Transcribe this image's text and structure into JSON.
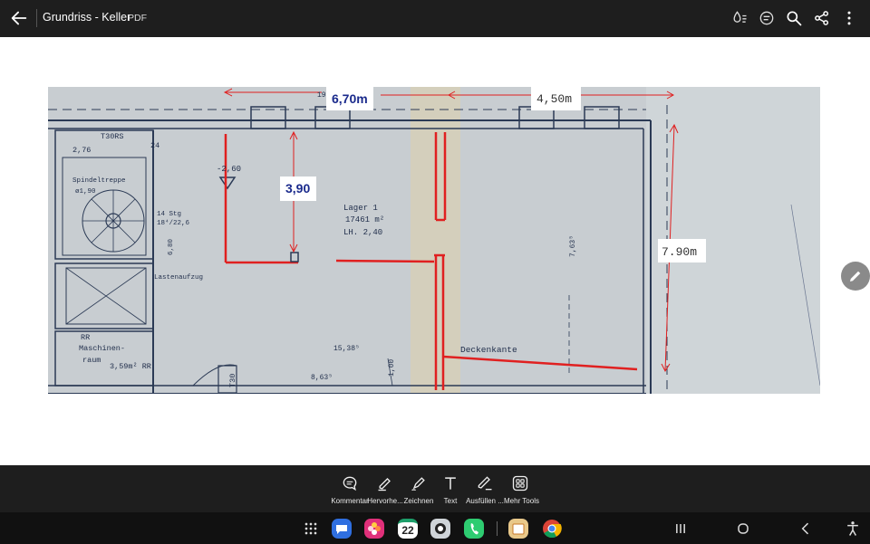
{
  "header": {
    "title": "Grundriss - Keller",
    "file_type": "PDF",
    "icons": [
      "back-arrow-icon",
      "read-aloud-icon",
      "ai-assistant-icon",
      "search-icon",
      "share-icon",
      "more-options-icon"
    ]
  },
  "document": {
    "annotations": {
      "width_red": "6,70m",
      "width_black": "4,50m",
      "height_room": "3,90",
      "height_right": "7.90m"
    },
    "plan_labels": {
      "lager_1": "Lager 1",
      "area": "17461 m²",
      "lh": "LH. 2,40",
      "spindel": "Spindeltreppe",
      "spindel_dim": "ø1,90",
      "stg": "14 Stg",
      "stg_dim": "18⁴/22,6",
      "lastenaufzug": "Lastenaufzug",
      "rr": "RR",
      "maschinen": "Maschinen-",
      "raum": "raum",
      "raum_area": "3,59m² RR",
      "deckenkante": "Deckenkante",
      "t30rs": "T30RS",
      "t30": "T30",
      "d276": "2,76",
      "d24": "24",
      "d260": "-2,60",
      "d680": "6,80",
      "d1538": "15,38⁵",
      "d863": "8,63⁵",
      "d100": "1,00",
      "d763": "7,63⁵",
      "d19": "19,"
    },
    "colors": {
      "markup_red": "#e02020",
      "dimension_blue": "#1a2a8c",
      "plan_ink": "#2b3a55"
    }
  },
  "edit_fab": {
    "icon": "pencil-icon"
  },
  "toolbar": {
    "tools": [
      {
        "label": "Kommentar",
        "icon": "comment-icon"
      },
      {
        "label": "Hervorhe...",
        "icon": "highlighter-icon"
      },
      {
        "label": "Zeichnen",
        "icon": "draw-pen-icon"
      },
      {
        "label": "Text",
        "icon": "text-icon"
      },
      {
        "label": "Ausfüllen ...",
        "icon": "fill-sign-icon"
      },
      {
        "label": "Mehr Tools",
        "icon": "more-tools-icon"
      }
    ]
  },
  "navbar": {
    "calendar_day": "22",
    "apps": [
      "app-drawer-icon",
      "messages-app-icon",
      "gallery-app-icon",
      "calendar-app-icon",
      "camera-app-icon",
      "phone-app-icon",
      "files-app-icon",
      "chrome-app-icon"
    ],
    "buttons": [
      "recent-apps-icon",
      "home-icon",
      "back-icon",
      "accessibility-icon"
    ]
  }
}
